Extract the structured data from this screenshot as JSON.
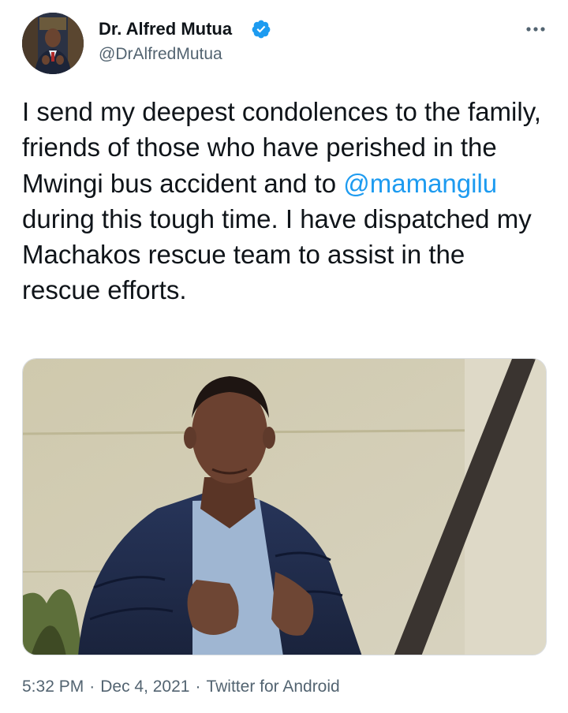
{
  "author": {
    "name": "Dr. Alfred Mutua",
    "handle": "@DrAlfredMutua",
    "verified_icon": "verified-badge-icon",
    "avatar_icon": "profile-photo"
  },
  "tweet": {
    "text_before_mention": "I send my deepest condolences to the family, friends of those who have perished in the Mwingi bus accident and to ",
    "mention": "@mamangilu",
    "text_after_mention": " during this tough time. I have dispatched my Machakos rescue team to assist in the rescue efforts."
  },
  "media": {
    "type": "video-still",
    "icon": "attached-photo"
  },
  "meta": {
    "time": "5:32 PM",
    "date": "Dec 4, 2021",
    "separator": "·",
    "source": "Twitter for Android"
  },
  "more_icon": "more-options-icon",
  "colors": {
    "text": "#0f1419",
    "secondary": "#536471",
    "accent": "#1d9bf0",
    "background": "#ffffff"
  }
}
